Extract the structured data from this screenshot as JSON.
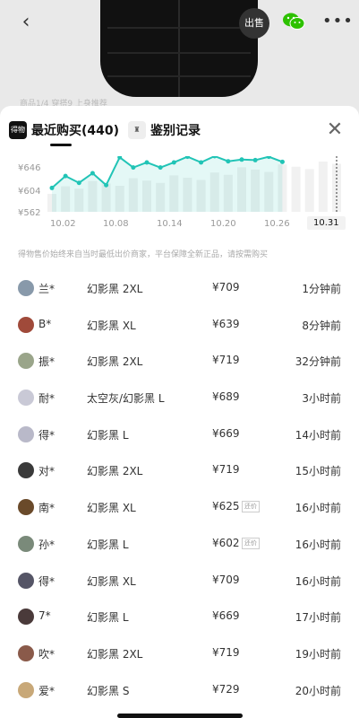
{
  "top_bar": {
    "sell_label": "出售",
    "background_nav": "商品1/4  穿搭9  上身推荐"
  },
  "sheet": {
    "tabs": [
      {
        "icon": "得物",
        "label": "最近购买(440)",
        "active": true
      },
      {
        "icon": "♜",
        "label": "鉴别记录",
        "active": false
      }
    ],
    "note": "得物售价始终来自当时最低出价商家，平台保障全新正品，请按需购买"
  },
  "chart_data": {
    "type": "line",
    "y_ticks": [
      "¥646",
      "¥604",
      "¥562"
    ],
    "x_ticks": [
      "10.02",
      "10.08",
      "10.14",
      "10.20",
      "10.26",
      "10.31"
    ],
    "active_x": "10.31",
    "ylim": [
      562,
      660
    ],
    "points": [
      {
        "x": 0,
        "y": 604
      },
      {
        "x": 1,
        "y": 625
      },
      {
        "x": 2,
        "y": 613
      },
      {
        "x": 3,
        "y": 630
      },
      {
        "x": 4,
        "y": 609
      },
      {
        "x": 5,
        "y": 658
      },
      {
        "x": 6,
        "y": 640
      },
      {
        "x": 7,
        "y": 649
      },
      {
        "x": 8,
        "y": 640
      },
      {
        "x": 9,
        "y": 649
      },
      {
        "x": 10,
        "y": 659
      },
      {
        "x": 11,
        "y": 649
      },
      {
        "x": 12,
        "y": 660
      },
      {
        "x": 13,
        "y": 651
      },
      {
        "x": 14,
        "y": 654
      },
      {
        "x": 15,
        "y": 653
      },
      {
        "x": 16,
        "y": 659
      },
      {
        "x": 17,
        "y": 650
      }
    ],
    "accent": "#21c4b6"
  },
  "purchases": [
    {
      "user": "兰*",
      "variant": "幻影黑 2XL",
      "price": "¥709",
      "tag": "",
      "time": "1分钟前",
      "avatar_color": "#8899aa"
    },
    {
      "user": "B*",
      "variant": "幻影黑 XL",
      "price": "¥639",
      "tag": "",
      "time": "8分钟前",
      "avatar_color": "#a04a3a"
    },
    {
      "user": "振*",
      "variant": "幻影黑 2XL",
      "price": "¥719",
      "tag": "",
      "time": "32分钟前",
      "avatar_color": "#9aa58a"
    },
    {
      "user": "耐*",
      "variant": "太空灰/幻影黑 L",
      "price": "¥689",
      "tag": "",
      "time": "3小时前",
      "avatar_color": "#c9c9d6"
    },
    {
      "user": "得*",
      "variant": "幻影黑 L",
      "price": "¥669",
      "tag": "",
      "time": "14小时前",
      "avatar_color": "#b9b9c9"
    },
    {
      "user": "对*",
      "variant": "幻影黑 2XL",
      "price": "¥719",
      "tag": "",
      "time": "15小时前",
      "avatar_color": "#3a3a3a"
    },
    {
      "user": "南*",
      "variant": "幻影黑 XL",
      "price": "¥625",
      "tag": "还价",
      "time": "16小时前",
      "avatar_color": "#6a4a2a"
    },
    {
      "user": "孙*",
      "variant": "幻影黑 L",
      "price": "¥602",
      "tag": "还价",
      "time": "16小时前",
      "avatar_color": "#7a8a7a"
    },
    {
      "user": "得*",
      "variant": "幻影黑 XL",
      "price": "¥709",
      "tag": "",
      "time": "16小时前",
      "avatar_color": "#555566"
    },
    {
      "user": "7*",
      "variant": "幻影黑 L",
      "price": "¥669",
      "tag": "",
      "time": "17小时前",
      "avatar_color": "#4a3a3a"
    },
    {
      "user": "吹*",
      "variant": "幻影黑 2XL",
      "price": "¥719",
      "tag": "",
      "time": "19小时前",
      "avatar_color": "#8a5a4a"
    },
    {
      "user": "爱*",
      "variant": "幻影黑 S",
      "price": "¥729",
      "tag": "",
      "time": "20小时前",
      "avatar_color": "#c8a878"
    }
  ]
}
